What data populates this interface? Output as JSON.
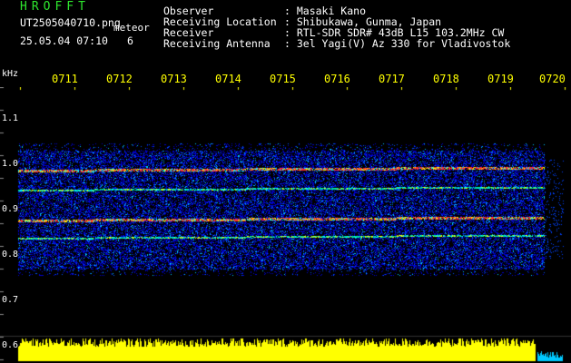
{
  "brand": "HROFFT",
  "file_name": "UT2505040710.png",
  "meteor_label": "meteor",
  "datetime": "25.05.04 07:10",
  "count": "6",
  "info": [
    {
      "label": "Observer",
      "value": ": Masaki Kano"
    },
    {
      "label": "Receiving Location",
      "value": ": Shibukawa, Gunma, Japan"
    },
    {
      "label": "Receiver",
      "value": ": RTL-SDR SDR# 43dB L15 103.2MHz CW"
    },
    {
      "label": "Receiving Antenna",
      "value": ": 3el Yagi(V) Az 330 for Vladivostok"
    }
  ],
  "time_ticks": [
    "0711",
    "0712",
    "0713",
    "0714",
    "0715",
    "0716",
    "0717",
    "0718",
    "0719",
    "0720"
  ],
  "y_unit": "kHz",
  "y_ticks": [
    "1.1",
    "1.0",
    "0.9",
    "0.8",
    "0.7",
    "0.6"
  ],
  "colors": {
    "brand": "#2ee62e",
    "ticks": "#ffff00",
    "signal": "#ff3030",
    "noise": "#0000ff",
    "activity": "#ffff00"
  }
}
